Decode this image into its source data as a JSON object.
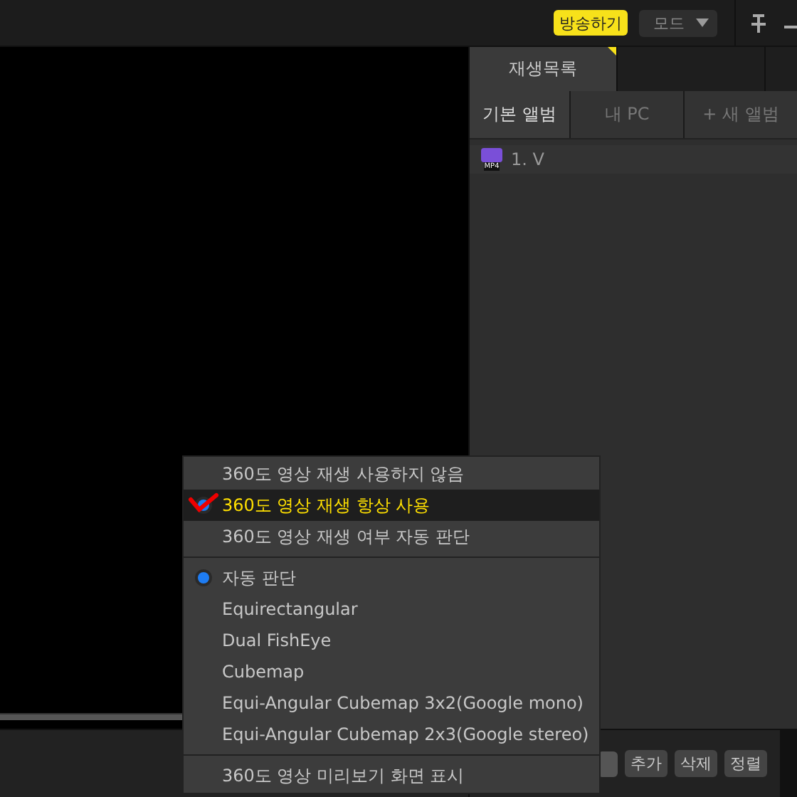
{
  "top_bar": {
    "broadcast_button": "방송하기",
    "mode_dropdown": "모드"
  },
  "playlist_panel": {
    "tabs": [
      {
        "label": "재생목록",
        "selected": true
      },
      {
        "selected": false
      }
    ],
    "album_tabs": [
      {
        "label": "기본 앨범",
        "selected": true
      },
      {
        "label": "내 PC",
        "selected": false
      },
      {
        "label": "+ 새 앨범",
        "selected": false
      }
    ],
    "items": [
      {
        "badge": "MP4",
        "title": "1. V"
      }
    ],
    "buttons": [
      "추가",
      "삭제",
      "정렬"
    ]
  },
  "context_menu": {
    "groups": [
      {
        "kind": "radio",
        "items": [
          {
            "label": "360도 영상 재생 사용하지 않음",
            "selected": false
          },
          {
            "label": "360도 영상 재생 항상 사용",
            "selected": true,
            "highlighted": true
          },
          {
            "label": "360도 영상 재생 여부 자동 판단",
            "selected": false
          }
        ]
      },
      {
        "kind": "radio",
        "items": [
          {
            "label": "자동 판단",
            "selected": true
          },
          {
            "label": "Equirectangular",
            "selected": false
          },
          {
            "label": "Dual FishEye",
            "selected": false
          },
          {
            "label": "Cubemap",
            "selected": false
          },
          {
            "label": "Equi-Angular Cubemap 3x2(Google mono)",
            "selected": false
          },
          {
            "label": "Equi-Angular Cubemap 2x3(Google stereo)",
            "selected": false
          }
        ]
      },
      {
        "kind": "action",
        "items": [
          {
            "label": "360도 영상 미리보기 화면 표시"
          }
        ]
      }
    ]
  }
}
